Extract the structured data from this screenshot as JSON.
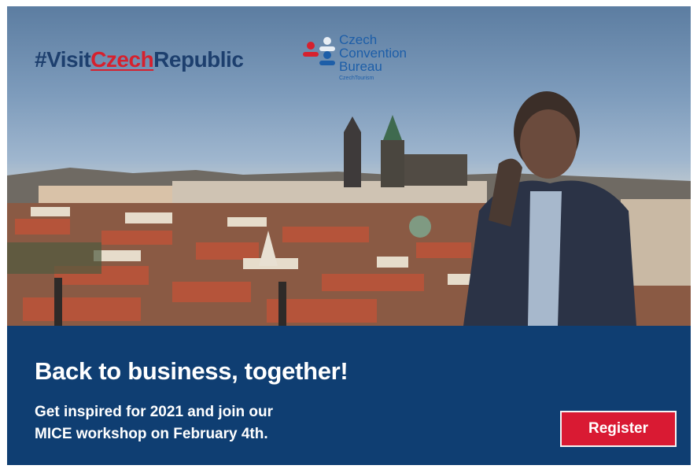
{
  "hashtag": {
    "prefix": "#Visit",
    "accent": "Czech",
    "suffix": "Republic"
  },
  "logo": {
    "lines": [
      "Czech",
      "Convention",
      "Bureau"
    ],
    "sub": "CzechTourism"
  },
  "headline": "Back to business, together!",
  "description": {
    "line1": "Get inspired for 2021 and join our",
    "line2": "MICE workshop on February 4th."
  },
  "cta": {
    "label": "Register"
  },
  "colors": {
    "brand_blue": "#0f3e72",
    "accent_red": "#d91a33",
    "logo_blue": "#1d5ea8"
  }
}
